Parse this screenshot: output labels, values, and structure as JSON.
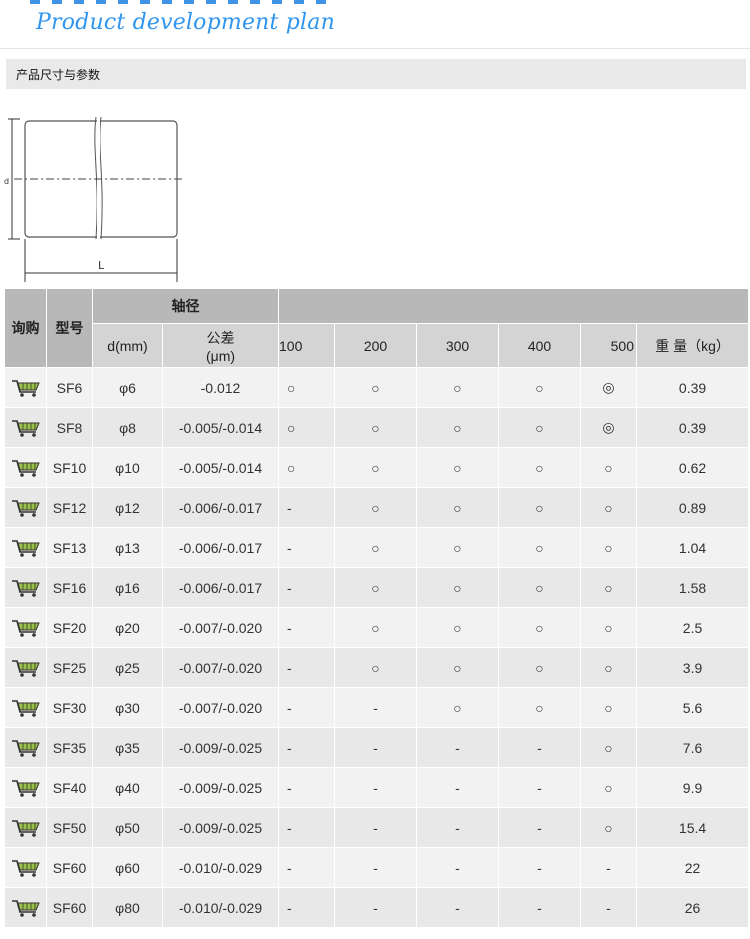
{
  "hero": {
    "title": "Product development plan"
  },
  "section": {
    "title": "产品尺寸与参数"
  },
  "diagram": {
    "dim_d": "d",
    "dim_l": "L"
  },
  "table": {
    "headers": {
      "inquire": "询购",
      "model": "型号",
      "shaft": "轴径",
      "d_mm": "d(mm)",
      "tol_line1": "公差",
      "tol_line2": "(μm)",
      "weight": "重 量（kg）"
    },
    "lengths": [
      "100",
      "200",
      "300",
      "400",
      "500"
    ],
    "rows": [
      {
        "model": "SF6",
        "d": "φ6",
        "tol": "-0.012",
        "m": [
          "○",
          "○",
          "○",
          "○",
          "◎"
        ],
        "w": "0.39"
      },
      {
        "model": "SF8",
        "d": "φ8",
        "tol": "-0.005/-0.014",
        "m": [
          "○",
          "○",
          "○",
          "○",
          "◎"
        ],
        "w": "0.39"
      },
      {
        "model": "SF10",
        "d": "φ10",
        "tol": "-0.005/-0.014",
        "m": [
          "○",
          "○",
          "○",
          "○",
          "○"
        ],
        "w": "0.62"
      },
      {
        "model": "SF12",
        "d": "φ12",
        "tol": "-0.006/-0.017",
        "m": [
          "-",
          "○",
          "○",
          "○",
          "○"
        ],
        "w": "0.89"
      },
      {
        "model": "SF13",
        "d": "φ13",
        "tol": "-0.006/-0.017",
        "m": [
          "-",
          "○",
          "○",
          "○",
          "○"
        ],
        "w": "1.04"
      },
      {
        "model": "SF16",
        "d": "φ16",
        "tol": "-0.006/-0.017",
        "m": [
          "-",
          "○",
          "○",
          "○",
          "○"
        ],
        "w": "1.58"
      },
      {
        "model": "SF20",
        "d": "φ20",
        "tol": "-0.007/-0.020",
        "m": [
          "-",
          "○",
          "○",
          "○",
          "○"
        ],
        "w": "2.5"
      },
      {
        "model": "SF25",
        "d": "φ25",
        "tol": "-0.007/-0.020",
        "m": [
          "-",
          "○",
          "○",
          "○",
          "○"
        ],
        "w": "3.9"
      },
      {
        "model": "SF30",
        "d": "φ30",
        "tol": "-0.007/-0.020",
        "m": [
          "-",
          "-",
          "○",
          "○",
          "○"
        ],
        "w": "5.6"
      },
      {
        "model": "SF35",
        "d": "φ35",
        "tol": "-0.009/-0.025",
        "m": [
          "-",
          "-",
          "-",
          "-",
          "○"
        ],
        "w": "7.6"
      },
      {
        "model": "SF40",
        "d": "φ40",
        "tol": "-0.009/-0.025",
        "m": [
          "-",
          "-",
          "-",
          "-",
          "○"
        ],
        "w": "9.9"
      },
      {
        "model": "SF50",
        "d": "φ50",
        "tol": "-0.009/-0.025",
        "m": [
          "-",
          "-",
          "-",
          "-",
          "○"
        ],
        "w": "15.4"
      },
      {
        "model": "SF60",
        "d": "φ60",
        "tol": "-0.010/-0.029",
        "m": [
          "-",
          "-",
          "-",
          "-",
          "-"
        ],
        "w": "22"
      },
      {
        "model": "SF60",
        "d": "φ80",
        "tol": "-0.010/-0.029",
        "m": [
          "-",
          "-",
          "-",
          "-",
          "-"
        ],
        "w": "26"
      }
    ]
  },
  "colors": {
    "title_blue": "#2f95ee",
    "header_gray": "#d4d4d4",
    "row_light": "#f2f2f2",
    "row_dark": "#e8e8e8"
  }
}
